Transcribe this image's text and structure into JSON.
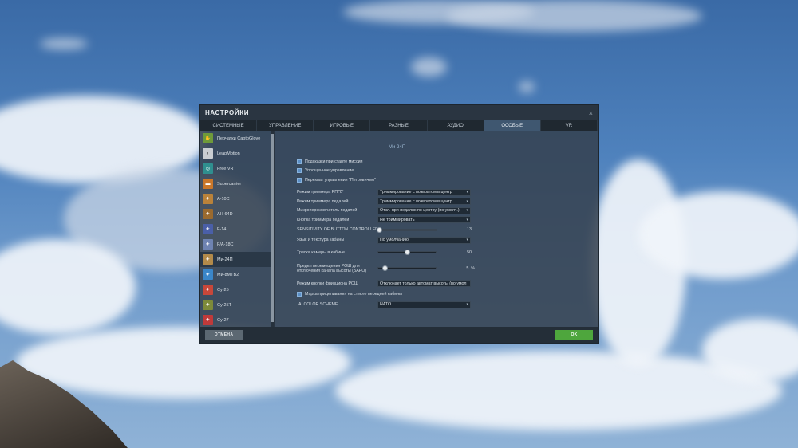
{
  "dialog": {
    "title": "НАСТРОЙКИ",
    "close_glyph": "×",
    "tabs": [
      {
        "label": "СИСТЕМНЫЕ",
        "active": false
      },
      {
        "label": "УПРАВЛЕНИЕ",
        "active": false
      },
      {
        "label": "ИГРОВЫЕ",
        "active": false
      },
      {
        "label": "РАЗНЫЕ",
        "active": false
      },
      {
        "label": "АУДИО",
        "active": false
      },
      {
        "label": "ОСОБЫЕ",
        "active": true
      },
      {
        "label": "VR",
        "active": false
      }
    ]
  },
  "sidebar": {
    "items": [
      {
        "label": "Перчатки CaptoGlove",
        "icon": "glove-icon",
        "color": "#6f9a3a"
      },
      {
        "label": "LeapMotion",
        "icon": "leap-icon",
        "color": "#c9cdd1"
      },
      {
        "label": "Free VR",
        "icon": "vr-icon",
        "color": "#2f8f8f"
      },
      {
        "label": "Supercarrier",
        "icon": "carrier-icon",
        "color": "#c9772a"
      },
      {
        "label": "A-10C",
        "icon": "aircraft-icon",
        "color": "#b9823a"
      },
      {
        "label": "AH-64D",
        "icon": "helicopter-icon",
        "color": "#9a6a2f"
      },
      {
        "label": "F-14",
        "icon": "aircraft-icon",
        "color": "#4a5fa8"
      },
      {
        "label": "F/A-18C",
        "icon": "aircraft-icon",
        "color": "#6e83b2"
      },
      {
        "label": "Ми-24П",
        "icon": "helicopter-icon",
        "color": "#b28a4a",
        "active": true
      },
      {
        "label": "Ми-8МТВ2",
        "icon": "helicopter-icon",
        "color": "#3a86c9"
      },
      {
        "label": "Су-25",
        "icon": "aircraft-icon",
        "color": "#c8473a"
      },
      {
        "label": "Су-25Т",
        "icon": "aircraft-icon",
        "color": "#7d8a3a"
      },
      {
        "label": "Су-27",
        "icon": "aircraft-icon",
        "color": "#c03a3a"
      }
    ]
  },
  "content": {
    "section_title": "Ми-24П",
    "checks": [
      {
        "label": "Подсказки при старте миссии",
        "checked": true
      },
      {
        "label": "Упрощенное управление",
        "checked": true
      },
      {
        "label": "Перехват управления \"Петровичем\"",
        "checked": true
      }
    ],
    "rows": [
      {
        "label": "Режим триммера РППУ",
        "value": "Триммирование с возвратом в центр"
      },
      {
        "label": "Режим триммера педалей",
        "value": "Триммирование с возвратом в центр"
      },
      {
        "label": "Микропереключатель педалей",
        "value": "Откл. при педалях по центру (по умолч.)"
      },
      {
        "label": "Кнопка триммера педалей",
        "value": "Не триммировать"
      }
    ],
    "sensitivity": {
      "label": "SENSITIVITY OF BUTTON CONTROLLED PEC",
      "value": "13",
      "fraction": 0.02
    },
    "language": {
      "label": "Язык и текстура кабины",
      "value": "По умолчанию"
    },
    "shake": {
      "label": "Тряска камеры в кабине",
      "value": "50",
      "fraction": 0.5
    },
    "limit": {
      "label_line1": "Предел перемещения РОШ для",
      "label_line2": "отключения канала высоты (БАРО)",
      "value": "5",
      "unit": "%",
      "fraction": 0.12
    },
    "rosh_mode": {
      "label": "Режим кнопки фрикциона РОШ",
      "value": "Отключает только автомат высоты (по умол"
    },
    "mark": {
      "label": "Марка прицеливания на стекле передней кабины",
      "checked": true
    },
    "ai_color": {
      "label": "AI COLOR SCHEME",
      "value": "НАТО"
    }
  },
  "footer": {
    "cancel_label": "ОТМЕНА",
    "ok_label": "OK"
  }
}
